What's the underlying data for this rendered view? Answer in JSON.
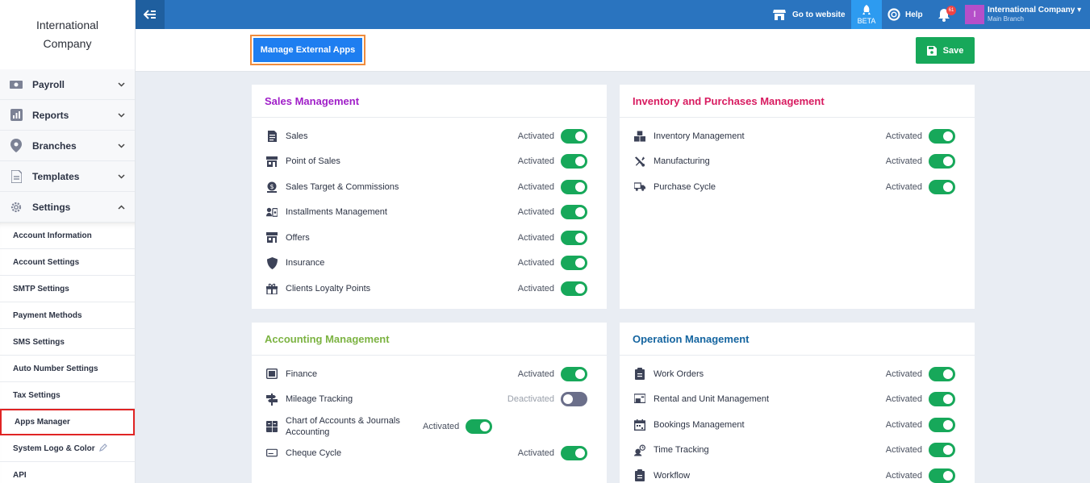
{
  "sidebar": {
    "brand": "International Company",
    "menu": [
      {
        "label": "Payroll",
        "icon": "money-icon",
        "expanded": false
      },
      {
        "label": "Reports",
        "icon": "chart-icon",
        "expanded": false
      },
      {
        "label": "Branches",
        "icon": "location-pin-icon",
        "expanded": false
      },
      {
        "label": "Templates",
        "icon": "document-icon",
        "expanded": false
      },
      {
        "label": "Settings",
        "icon": "gear-icon",
        "expanded": true
      }
    ],
    "settings_items": [
      {
        "label": "Account Information"
      },
      {
        "label": "Account Settings"
      },
      {
        "label": "SMTP Settings"
      },
      {
        "label": "Payment Methods"
      },
      {
        "label": "SMS Settings"
      },
      {
        "label": "Auto Number Settings"
      },
      {
        "label": "Tax Settings"
      },
      {
        "label": "Apps Manager",
        "active": true
      },
      {
        "label": "System Logo & Color"
      },
      {
        "label": "API"
      }
    ]
  },
  "topbar": {
    "website_label": "Go to website",
    "beta_label": "BETA",
    "help_label": "Help",
    "notification_count": "61",
    "user_initial": "I",
    "user_name": "International Company",
    "branch_name": "Main Branch"
  },
  "actions": {
    "manage_label": "Manage External Apps",
    "save_label": "Save"
  },
  "colors": {
    "topbar": "#2a74bf",
    "accent": "#1e7ef0",
    "toggle_on": "#17a85a",
    "toggle_off": "#6b6f8a",
    "sales_title": "#a01fc8",
    "inventory_title": "#d81b60",
    "accounting_title": "#7cb342",
    "operation_title": "#1565a0"
  },
  "sections": {
    "sales": {
      "title": "Sales Management",
      "items": [
        {
          "label": "Sales",
          "icon": "invoice-icon",
          "status": "Activated",
          "on": true
        },
        {
          "label": "Point of Sales",
          "icon": "store-icon",
          "status": "Activated",
          "on": true
        },
        {
          "label": "Sales Target & Commissions",
          "icon": "dollar-coin-icon",
          "status": "Activated",
          "on": true
        },
        {
          "label": "Installments Management",
          "icon": "installments-icon",
          "status": "Activated",
          "on": true
        },
        {
          "label": "Offers",
          "icon": "store-icon",
          "status": "Activated",
          "on": true
        },
        {
          "label": "Insurance",
          "icon": "shield-icon",
          "status": "Activated",
          "on": true
        },
        {
          "label": "Clients Loyalty Points",
          "icon": "gift-icon",
          "status": "Activated",
          "on": true
        }
      ]
    },
    "inventory": {
      "title": "Inventory and Purchases Management",
      "items": [
        {
          "label": "Inventory Management",
          "icon": "boxes-icon",
          "status": "Activated",
          "on": true
        },
        {
          "label": "Manufacturing",
          "icon": "tools-icon",
          "status": "Activated",
          "on": true
        },
        {
          "label": "Purchase Cycle",
          "icon": "truck-icon",
          "status": "Activated",
          "on": true
        }
      ]
    },
    "accounting": {
      "title": "Accounting Management",
      "items": [
        {
          "label": "Finance",
          "icon": "safe-icon",
          "status": "Activated",
          "on": true
        },
        {
          "label": "Mileage Tracking",
          "icon": "signpost-icon",
          "status": "Deactivated",
          "on": false
        },
        {
          "label": "Chart of Accounts & Journals Accounting",
          "icon": "calculator-icon",
          "status": "Activated",
          "on": true
        },
        {
          "label": "Cheque Cycle",
          "icon": "cheque-icon",
          "status": "Activated",
          "on": true
        }
      ]
    },
    "operation": {
      "title": "Operation Management",
      "items": [
        {
          "label": "Work Orders",
          "icon": "clipboard-icon",
          "status": "Activated",
          "on": true
        },
        {
          "label": "Rental and Unit Management",
          "icon": "rental-icon",
          "status": "Activated",
          "on": true
        },
        {
          "label": "Bookings Management",
          "icon": "calendar-icon",
          "status": "Activated",
          "on": true
        },
        {
          "label": "Time Tracking",
          "icon": "time-tracking-icon",
          "status": "Activated",
          "on": true
        },
        {
          "label": "Workflow",
          "icon": "clipboard-icon",
          "status": "Activated",
          "on": true
        }
      ]
    }
  }
}
